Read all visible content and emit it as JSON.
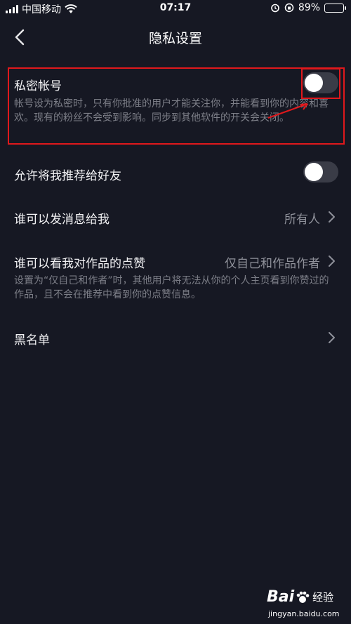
{
  "status_bar": {
    "carrier": "中国移动",
    "time": "07:17",
    "battery": "89%",
    "battery_level": 0.89
  },
  "nav": {
    "title": "隐私设置"
  },
  "private_account": {
    "label": "私密帐号",
    "description": "帐号设为私密时，只有你批准的用户才能关注你，并能看到你的内容和喜欢。现有的粉丝不会受到影响。同步到其他软件的开关会关闭。",
    "enabled": false
  },
  "recommend_to_friends": {
    "label": "允许将我推荐给好友",
    "enabled": false
  },
  "who_can_message": {
    "label": "谁可以发消息给我",
    "value": "所有人"
  },
  "who_can_see_likes": {
    "label": "谁可以看我对作品的点赞",
    "value": "仅自己和作品作者",
    "description": "设置为“仅自己和作者”时，其他用户将无法从你的个人主页看到你赞过的作品，且不会在推荐中看到你的点赞信息。"
  },
  "blacklist": {
    "label": "黑名单"
  },
  "watermark": {
    "brand": "Bai",
    "brand_suffix": "经验",
    "url": "jingyan.baidu.com"
  },
  "colors": {
    "background": "#161823",
    "annotation": "#e0181c",
    "toggle_off": "#3a3c47"
  }
}
